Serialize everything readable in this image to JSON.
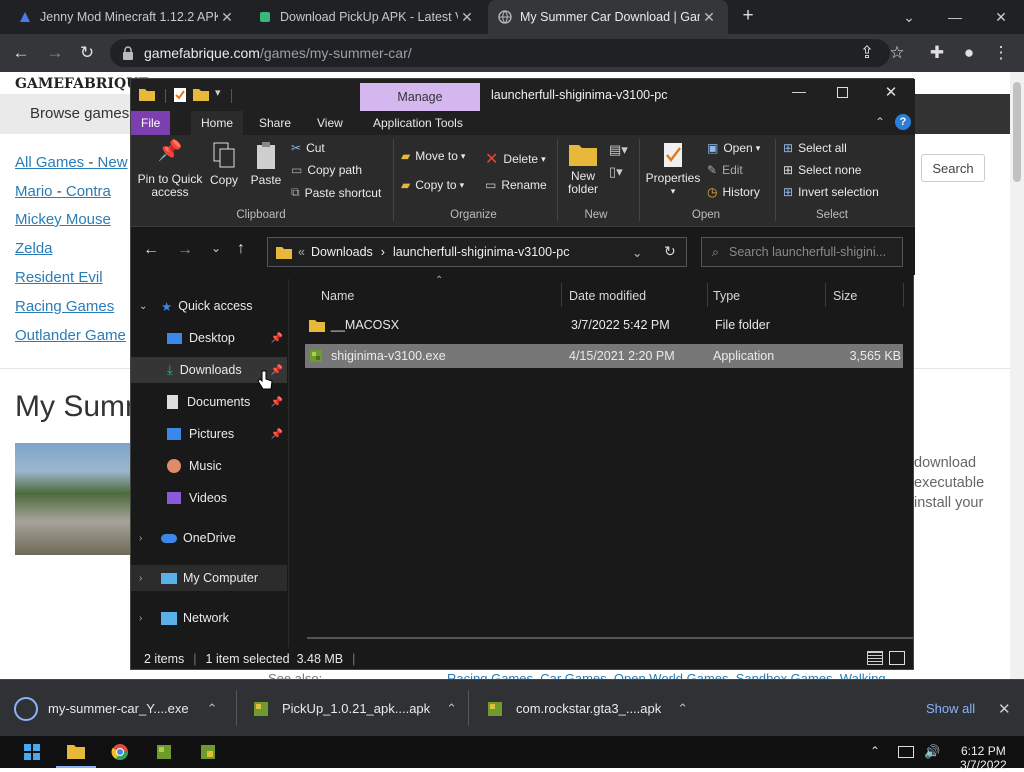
{
  "browser": {
    "tabs": [
      {
        "title": "Jenny Mod Minecraft 1.12.2 APK",
        "favicon": "a-logo-icon",
        "active": false
      },
      {
        "title": "Download PickUp APK - Latest Ve",
        "favicon": "android-icon",
        "active": false
      },
      {
        "title": "My Summer Car Download | Gam",
        "favicon": "globe-icon",
        "active": true
      }
    ],
    "new_tab": "+",
    "url_host": "gamefabrique.com",
    "url_path": "/games/my-summer-car/"
  },
  "website": {
    "logo": "GAMEFABRIQUE",
    "browse_label": "Browse games",
    "search_button": "Search",
    "links": [
      {
        "parts": [
          "All Games",
          "New"
        ],
        "sep": "-"
      },
      {
        "parts": [
          "Mario",
          "Contra"
        ],
        "sep": "-"
      },
      {
        "parts": [
          "Mickey Mouse"
        ]
      },
      {
        "parts": [
          "Zelda"
        ]
      },
      {
        "parts": [
          "Resident Evil"
        ]
      },
      {
        "parts": [
          "Racing Games"
        ]
      },
      {
        "parts": [
          "Outlander Game"
        ]
      }
    ],
    "heading": "My Summ",
    "side_text": [
      "download",
      "executable",
      "install your"
    ],
    "see_also": "See also:",
    "footer_tags": "Racing Games, Car Games, Open World Games, Sandbox Games, Walking"
  },
  "explorer": {
    "window_path": "launcherfull-shiginima-v3100-pc",
    "manage_tab": "Manage",
    "ribbon_tabs": [
      "File",
      "Home",
      "Share",
      "View",
      "Application Tools"
    ],
    "clipboard": {
      "pin": "Pin to Quick access",
      "copy": "Copy",
      "paste": "Paste",
      "cut": "Cut",
      "copy_path": "Copy path",
      "paste_shortcut": "Paste shortcut",
      "group": "Clipboard"
    },
    "organize": {
      "move_to": "Move to",
      "copy_to": "Copy to",
      "delete": "Delete",
      "rename": "Rename",
      "group": "Organize"
    },
    "new": {
      "new_folder": "New folder",
      "group": "New"
    },
    "open": {
      "properties": "Properties",
      "open": "Open",
      "edit": "Edit",
      "history": "History",
      "group": "Open"
    },
    "select": {
      "select_all": "Select all",
      "select_none": "Select none",
      "invert": "Invert selection",
      "group": "Select"
    },
    "breadcrumb": {
      "prefix": "«",
      "items": [
        "Downloads",
        "launcherfull-shiginima-v3100-pc"
      ]
    },
    "search_placeholder": "Search launcherfull-shigini...",
    "nav": {
      "quick_access": "Quick access",
      "items": [
        {
          "label": "Desktop",
          "icon": "desktop-icon",
          "pinned": true
        },
        {
          "label": "Downloads",
          "icon": "downloads-icon",
          "pinned": true
        },
        {
          "label": "Documents",
          "icon": "documents-icon",
          "pinned": true
        },
        {
          "label": "Pictures",
          "icon": "pictures-icon",
          "pinned": true
        },
        {
          "label": "Music",
          "icon": "music-icon",
          "pinned": false
        },
        {
          "label": "Videos",
          "icon": "videos-icon",
          "pinned": false
        }
      ],
      "onedrive": "OneDrive",
      "my_computer": "My Computer",
      "network": "Network"
    },
    "columns": {
      "name": "Name",
      "date": "Date modified",
      "type": "Type",
      "size": "Size"
    },
    "files": [
      {
        "name": "__MACOSX",
        "date": "3/7/2022 5:42 PM",
        "type": "File folder",
        "size": "",
        "icon": "folder-icon",
        "selected": false
      },
      {
        "name": "shiginima-v3100.exe",
        "date": "4/15/2021 2:20 PM",
        "type": "Application",
        "size": "3,565 KB",
        "icon": "minecraft-block-icon",
        "selected": true
      }
    ],
    "status": {
      "count": "2 items",
      "selected": "1 item selected  3.48 MB"
    }
  },
  "downloads": {
    "items": [
      "my-summer-car_Y....exe",
      "PickUp_1.0.21_apk....apk",
      "com.rockstar.gta3_....apk"
    ],
    "show_all": "Show all"
  },
  "taskbar": {
    "time": "6:12 PM",
    "date": "3/7/2022"
  },
  "colors": {
    "accent": "#7b3fb0",
    "manage": "#d5b7f0",
    "link": "#2a7cb7"
  }
}
